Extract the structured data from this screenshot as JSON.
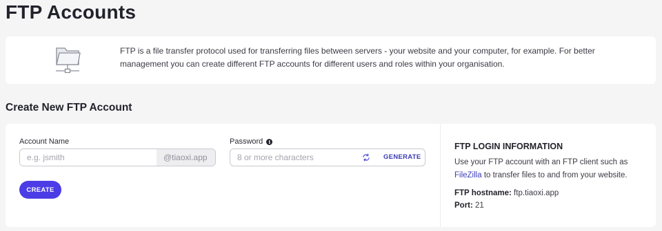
{
  "page": {
    "title": "FTP Accounts"
  },
  "intro": {
    "text": "FTP is a file transfer protocol used for transferring files between servers - your website and your computer, for example. For better management you can create different FTP accounts for different users and roles within your organisation.",
    "icon": "folder-network-icon"
  },
  "create_section": {
    "title": "Create New FTP Account",
    "account_name": {
      "label": "Account Name",
      "placeholder": "e.g. jsmith",
      "value": "",
      "suffix": "@tiaoxi.app"
    },
    "password": {
      "label": "Password",
      "info_icon": "info-icon",
      "placeholder": "8 or more characters",
      "value": "",
      "generate_icon": "refresh-icon",
      "generate_label": "GENERATE"
    },
    "create_label": "CREATE"
  },
  "login_info": {
    "title": "FTP LOGIN INFORMATION",
    "text_before": "Use your FTP account with an FTP client such as ",
    "link_text": "FileZilla",
    "text_after": " to transfer files to and from your website.",
    "hostname_label": "FTP hostname:",
    "hostname_value": " ftp.tiaoxi.app",
    "port_label": "Port:",
    "port_value": " 21"
  },
  "colors": {
    "accent": "#4b3ce6",
    "link": "#3b3bb8",
    "background": "#f5f5f6",
    "card": "#ffffff"
  }
}
